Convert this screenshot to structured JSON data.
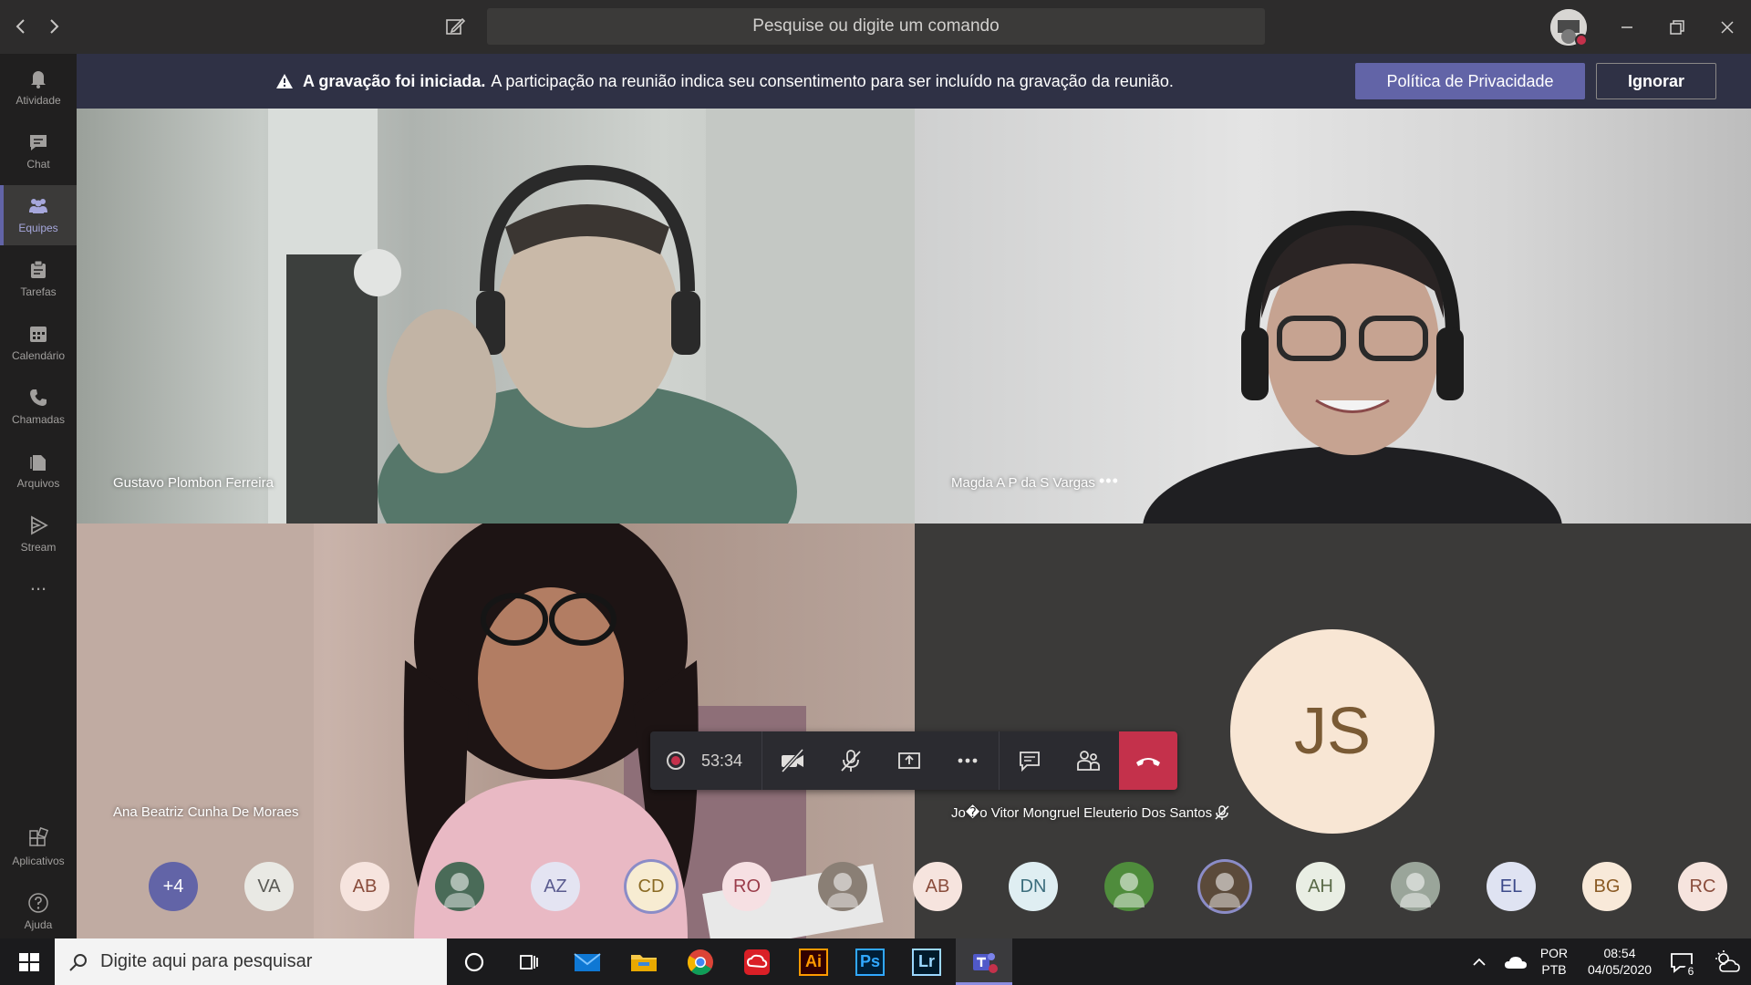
{
  "titlebar": {
    "search_placeholder": "Pesquise ou digite um comando"
  },
  "rail": {
    "items": [
      {
        "label": "Atividade",
        "icon": "bell-icon"
      },
      {
        "label": "Chat",
        "icon": "chat-icon"
      },
      {
        "label": "Equipes",
        "icon": "teams-icon"
      },
      {
        "label": "Tarefas",
        "icon": "tasks-icon"
      },
      {
        "label": "Calendário",
        "icon": "calendar-icon"
      },
      {
        "label": "Chamadas",
        "icon": "phone-icon"
      },
      {
        "label": "Arquivos",
        "icon": "files-icon"
      },
      {
        "label": "Stream",
        "icon": "stream-icon"
      }
    ],
    "more": "...",
    "apps_label": "Aplicativos",
    "help_label": "Ajuda"
  },
  "banner": {
    "bold": "A gravação foi iniciada.",
    "text": "A participação na reunião indica seu consentimento para ser incluído na gravação da reunião.",
    "privacy_button": "Política de Privacidade",
    "ignore_button": "Ignorar"
  },
  "tiles": [
    {
      "name": "Gustavo Plombon Ferreira"
    },
    {
      "name": "Magda A P da S Vargas"
    },
    {
      "name": "Ana Beatriz Cunha De Moraes"
    },
    {
      "name": "Jo�o Vitor Mongruel Eleuterio Dos Santos",
      "initials": "JS"
    }
  ],
  "controls": {
    "timer": "53:34"
  },
  "strip": [
    {
      "label": "+4",
      "bg": "#6264a7",
      "fg": "#ffffff"
    },
    {
      "label": "VA",
      "bg": "#e9e9e4",
      "fg": "#5a5a55"
    },
    {
      "label": "AB",
      "bg": "#f6e4de",
      "fg": "#8a4d3c"
    },
    {
      "label": "",
      "bg": "#4a6b58",
      "fg": "#ffffff",
      "photo": true
    },
    {
      "label": "AZ",
      "bg": "#e4e4f2",
      "fg": "#5a5b8f"
    },
    {
      "label": "CD",
      "bg": "#f7ecd2",
      "fg": "#8a6a24",
      "ring": true
    },
    {
      "label": "RO",
      "bg": "#f6e0e3",
      "fg": "#9a3c4a"
    },
    {
      "label": "",
      "bg": "#8a7f75",
      "fg": "#ffffff",
      "photo": true
    },
    {
      "label": "AB",
      "bg": "#f6e4de",
      "fg": "#8a4d3c"
    },
    {
      "label": "DN",
      "bg": "#dfeef2",
      "fg": "#3c6e7d"
    },
    {
      "label": "",
      "bg": "#4f8c3c",
      "fg": "#ffffff",
      "photo": true
    },
    {
      "label": "",
      "bg": "#5b4a3a",
      "fg": "#ffffff",
      "photo": true,
      "ring": true
    },
    {
      "label": "AH",
      "bg": "#e9eee4",
      "fg": "#5a6a48"
    },
    {
      "label": "",
      "bg": "#9aa59a",
      "fg": "#ffffff",
      "photo": true
    },
    {
      "label": "EL",
      "bg": "#dfe3f2",
      "fg": "#3c4a8a"
    },
    {
      "label": "BG",
      "bg": "#f8e9d9",
      "fg": "#8a5a24"
    },
    {
      "label": "RC",
      "bg": "#f6e4de",
      "fg": "#8a4d3c"
    }
  ],
  "taskbar": {
    "search_placeholder": "Digite aqui para pesquisar",
    "lang_top": "POR",
    "lang_bottom": "PTB",
    "time": "08:54",
    "date": "04/05/2020",
    "notifications": "6",
    "ai_label": "Ai",
    "ps_label": "Ps",
    "lr_label": "Lr"
  },
  "colors": {
    "accent": "#6264a7",
    "hangup": "#c4314b",
    "banner_bg": "#2f3145"
  }
}
